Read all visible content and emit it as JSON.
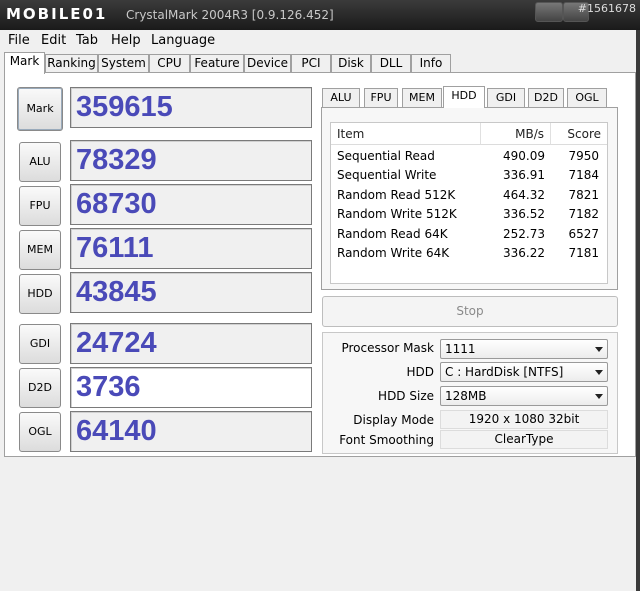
{
  "window": {
    "title": "CrystalMark 2004R3 [0.9.126.452]",
    "watermark": "MOBILE01",
    "watermark_id": "#1561678"
  },
  "menu": [
    "File",
    "Edit",
    "Tab",
    "Help",
    "Language"
  ],
  "main_tabs": [
    "Mark",
    "Ranking",
    "System",
    "CPU",
    "Feature",
    "Device",
    "PCI",
    "Disk",
    "DLL",
    "Info"
  ],
  "active_main_tab": "Mark",
  "scores": [
    {
      "label": "Mark",
      "value": "359615"
    },
    {
      "label": "ALU",
      "value": "78329"
    },
    {
      "label": "FPU",
      "value": "68730"
    },
    {
      "label": "MEM",
      "value": "76111"
    },
    {
      "label": "HDD",
      "value": "43845"
    },
    {
      "label": "GDI",
      "value": "24724"
    },
    {
      "label": "D2D",
      "value": "3736"
    },
    {
      "label": "OGL",
      "value": "64140"
    }
  ],
  "sub_tabs": [
    "ALU",
    "FPU",
    "MEM",
    "HDD",
    "GDI",
    "D2D",
    "OGL"
  ],
  "active_sub_tab": "HDD",
  "hdd_table": {
    "headers": [
      "Item",
      "MB/s",
      "Score"
    ],
    "rows": [
      [
        "Sequential Read",
        "490.09",
        "7950"
      ],
      [
        "Sequential Write",
        "336.91",
        "7184"
      ],
      [
        "Random Read 512K",
        "464.32",
        "7821"
      ],
      [
        "Random Write 512K",
        "336.52",
        "7182"
      ],
      [
        "Random Read 64K",
        "252.73",
        "6527"
      ],
      [
        "Random Write 64K",
        "336.22",
        "7181"
      ]
    ]
  },
  "stop_label": "Stop",
  "settings": {
    "processor_mask_label": "Processor Mask",
    "processor_mask_value": "1111",
    "hdd_label": "HDD",
    "hdd_value": "C : HardDisk [NTFS]",
    "hdd_size_label": "HDD Size",
    "hdd_size_value": "128MB",
    "display_mode_label": "Display Mode",
    "display_mode_value": "1920 x 1080 32bit",
    "font_smoothing_label": "Font Smoothing",
    "font_smoothing_value": "ClearType"
  },
  "colors": {
    "score_text": "#4a4ab8",
    "titlebar": "#1a1a1a"
  }
}
